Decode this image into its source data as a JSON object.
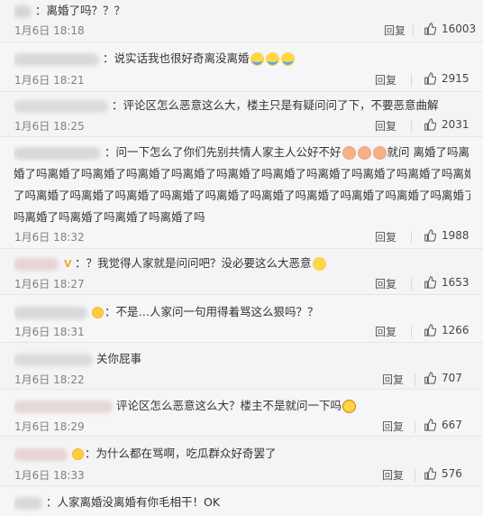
{
  "comments": [
    {
      "lines": [
        "：离婚了吗？？？"
      ],
      "time": "1月6日 18:18",
      "reply": "回复",
      "likes": "16003"
    },
    {
      "lines": [
        "：说实话我也很好奇离没离婚"
      ],
      "time": "1月6日 18:21",
      "reply": "回复",
      "likes": "2915"
    },
    {
      "lines": [
        "：评论区怎么恶意这么大，楼主只是有疑问问了下，不要恶意曲解"
      ],
      "time": "1月6日 18:25",
      "reply": "回复",
      "likes": "2031"
    },
    {
      "lines": [
        "：问一下怎么了你们先别共情人家主人公好不好",
        "就问 离婚了吗离",
        "婚了吗离婚了吗离婚了吗离婚了吗离婚了吗离婚了吗离婚了吗离婚了吗离婚了吗离婚了吗离婚了吗离婚",
        "了吗离婚了吗离婚了吗离婚了吗离婚了吗离婚了吗离婚了吗离婚了吗离婚了吗离婚了吗离婚了吗离婚了",
        "吗离婚了吗离婚了吗离婚了吗离婚了吗"
      ],
      "time": "1月6日 18:32",
      "reply": "回复",
      "likes": "1988"
    },
    {
      "lines": [
        "：？我觉得人家就是问问吧？没必要这么大恶意"
      ],
      "time": "1月6日 18:27",
      "reply": "回复",
      "likes": "1653"
    },
    {
      "lines": [
        "：不是…人家问一句用得着骂这么狠吗？？"
      ],
      "time": "1月6日 18:31",
      "reply": "回复",
      "likes": "1266"
    },
    {
      "lines": [
        "关你屁事"
      ],
      "time": "1月6日 18:22",
      "reply": "回复",
      "likes": "707"
    },
    {
      "lines": [
        "评论区怎么恶意这么大？楼主不是就问一下吗"
      ],
      "time": "1月6日 18:29",
      "reply": "回复",
      "likes": "667"
    },
    {
      "lines": [
        "：为什么都在骂啊，吃瓜群众好奇罢了"
      ],
      "time": "1月6日 18:33",
      "reply": "回复",
      "likes": "576"
    },
    {
      "lines": [
        "：人家离婚没离婚有你毛相干！OK"
      ],
      "time": "",
      "reply": "",
      "likes": ""
    }
  ],
  "colors": {
    "background": "#f4f4f6",
    "text": "#333333",
    "meta": "#808080"
  },
  "icons": [
    "thumbs-up-icon",
    "cry-laugh-emoji",
    "face-emoji",
    "smug-emoji",
    "shock-emoji",
    "angry-emoji"
  ]
}
